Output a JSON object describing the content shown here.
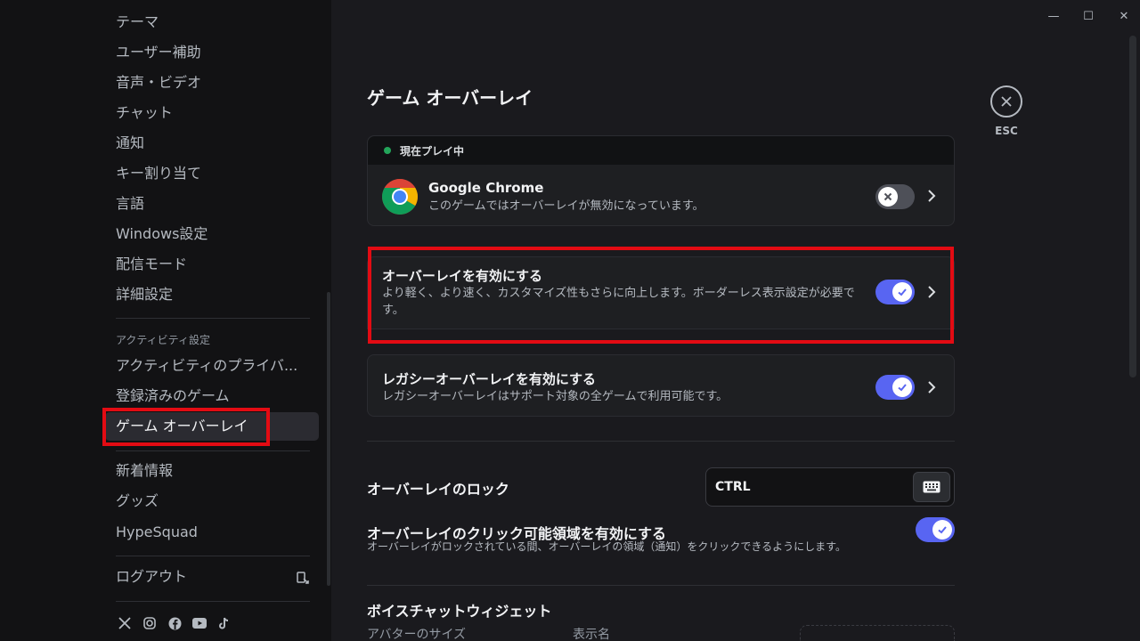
{
  "window": {
    "minimize_glyph": "—",
    "maximize_glyph": "☐",
    "close_glyph": "✕"
  },
  "sidebar": {
    "items_top": [
      {
        "label": "テーマ"
      },
      {
        "label": "ユーザー補助"
      },
      {
        "label": "音声・ビデオ"
      },
      {
        "label": "チャット"
      },
      {
        "label": "通知"
      },
      {
        "label": "キー割り当て"
      },
      {
        "label": "言語"
      },
      {
        "label": "Windows設定"
      },
      {
        "label": "配信モード"
      },
      {
        "label": "詳細設定"
      }
    ],
    "activity_header": "アクティビティ設定",
    "activity_items": [
      {
        "label": "アクティビティのプライバ..."
      },
      {
        "label": "登録済みのゲーム"
      },
      {
        "label": "ゲーム オーバーレイ"
      }
    ],
    "misc_items": [
      {
        "label": "新着情報"
      },
      {
        "label": "グッズ"
      },
      {
        "label": "HypeSquad"
      }
    ],
    "logout_label": "ログアウト",
    "socials": [
      "x-icon",
      "instagram-icon",
      "facebook-icon",
      "youtube-icon",
      "tiktok-icon"
    ]
  },
  "main": {
    "title": "ゲーム オーバーレイ",
    "esc_label": "ESC",
    "now_playing": {
      "header": "現在プレイ中",
      "app_name": "Google Chrome",
      "app_desc": "このゲームではオーバーレイが無効になっています。",
      "toggle_on": false
    },
    "enable_overlay": {
      "title": "オーバーレイを有効にする",
      "desc": "より軽く、より速く、カスタマイズ性もさらに向上します。ボーダーレス表示設定が必要です。",
      "toggle_on": true
    },
    "legacy_overlay": {
      "title": "レガシーオーバーレイを有効にする",
      "desc": "レガシーオーバーレイはサポート対象の全ゲームで利用可能です。",
      "toggle_on": true
    },
    "overlay_lock": {
      "title": "オーバーレイのロック",
      "keybind": "CTRL"
    },
    "clickable_zones": {
      "title": "オーバーレイのクリック可能領域を有効にする",
      "desc": "オーバーレイがロックされている間、オーバーレイの領域（通知）をクリックできるようにします。",
      "toggle_on": true
    },
    "voice_widget": {
      "title": "ボイスチャットウィジェット",
      "avatar_size_label": "アバターのサイズ",
      "display_name_label": "表示名"
    }
  },
  "colors": {
    "accent": "#5865f2",
    "highlight": "#e30b13",
    "online": "#23a55a"
  }
}
